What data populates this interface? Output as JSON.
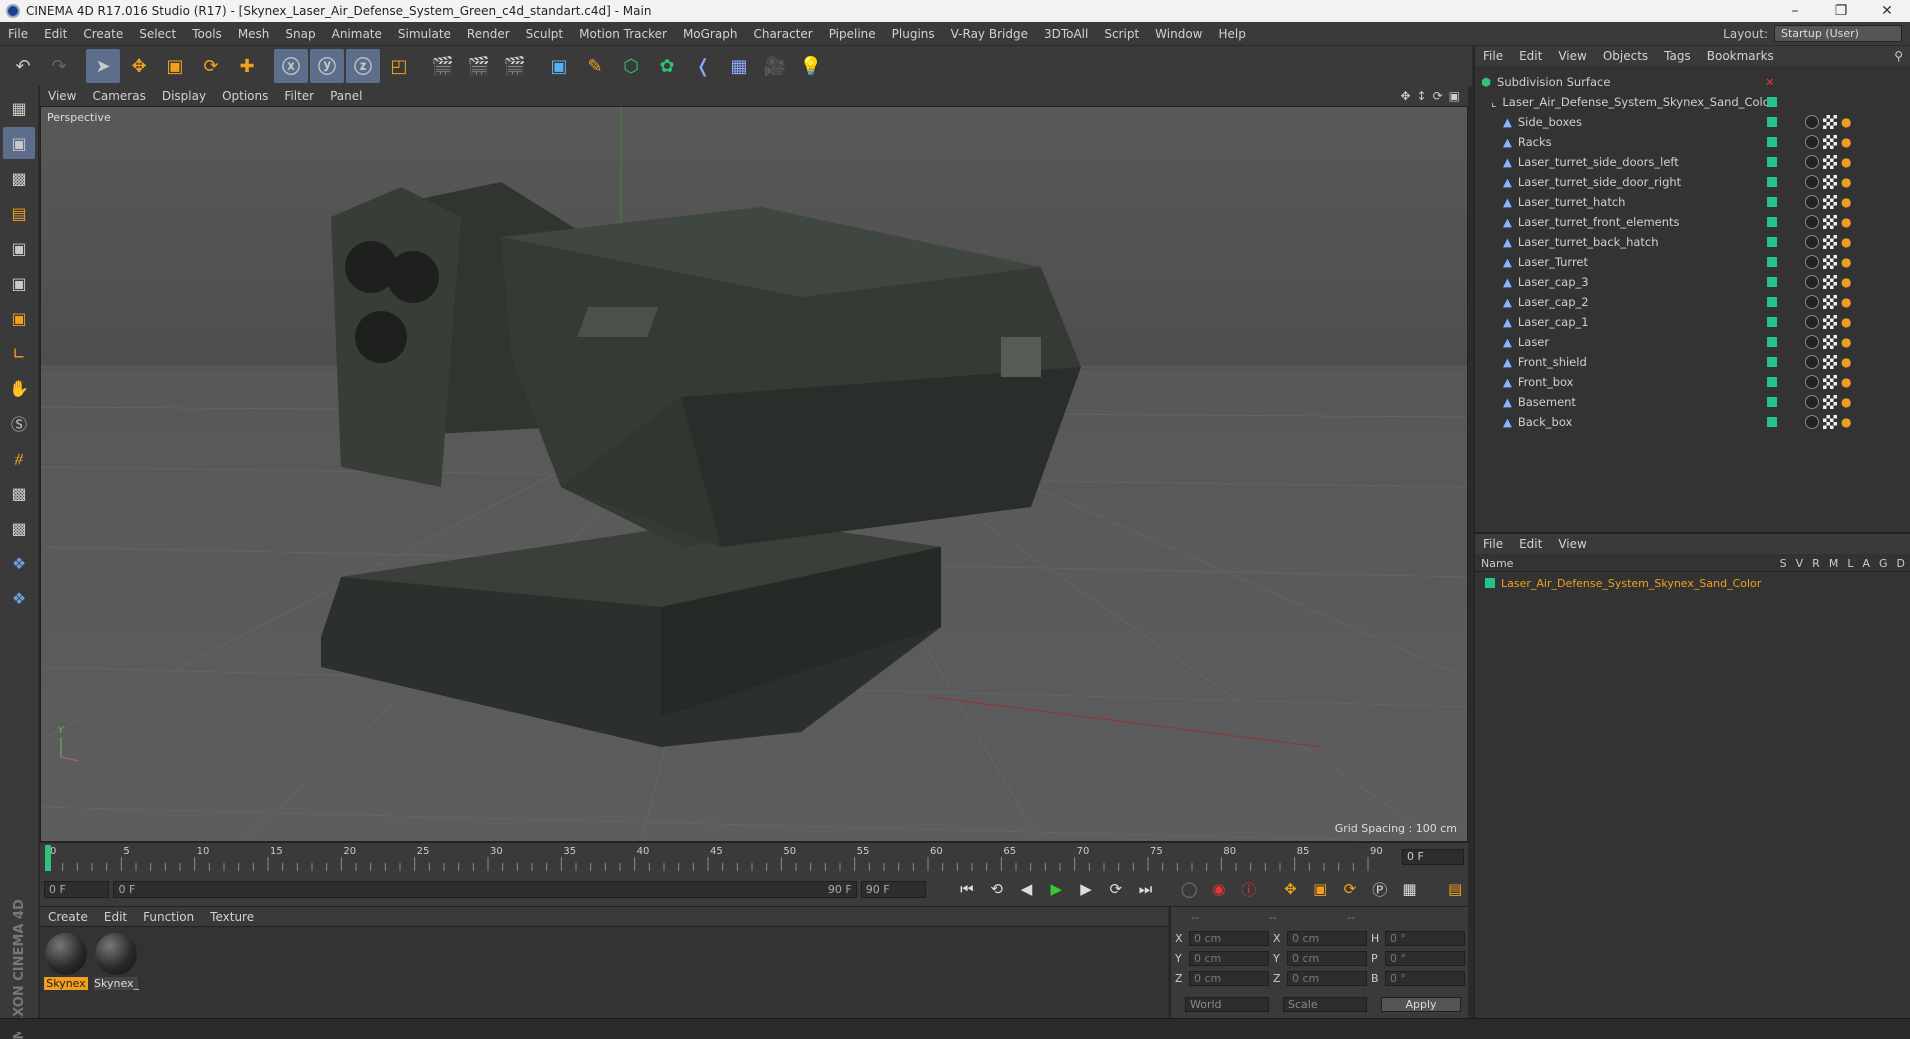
{
  "window": {
    "title": "CINEMA 4D R17.016 Studio (R17) - [Skynex_Laser_Air_Defense_System_Green_c4d_standart.c4d] - Main"
  },
  "menu": [
    "File",
    "Edit",
    "Create",
    "Select",
    "Tools",
    "Mesh",
    "Snap",
    "Animate",
    "Simulate",
    "Render",
    "Sculpt",
    "Motion Tracker",
    "MoGraph",
    "Character",
    "Pipeline",
    "Plugins",
    "V-Ray Bridge",
    "3DToAll",
    "Script",
    "Window",
    "Help"
  ],
  "layout": {
    "label": "Layout:",
    "value": "Startup (User)"
  },
  "viewport": {
    "menu": [
      "View",
      "Cameras",
      "Display",
      "Options",
      "Filter",
      "Panel"
    ],
    "camera": "Perspective",
    "grid_spacing": "Grid Spacing : 100 cm"
  },
  "timeline": {
    "ticks": [
      "0",
      "5",
      "10",
      "15",
      "20",
      "25",
      "30",
      "35",
      "40",
      "45",
      "50",
      "55",
      "60",
      "65",
      "70",
      "75",
      "80",
      "85",
      "90"
    ],
    "current_frame": "0 F",
    "start": "0 F",
    "range_start": "0 F",
    "range_end": "90 F",
    "end": "90 F"
  },
  "material_manager": {
    "menu": [
      "Create",
      "Edit",
      "Function",
      "Texture"
    ],
    "materials": [
      {
        "label": "Skynex",
        "selected": true
      },
      {
        "label": "Skynex_",
        "selected": false
      }
    ]
  },
  "coordinates": {
    "header": [
      "--",
      "--",
      "--"
    ],
    "rows": [
      {
        "a": "X",
        "av": "0 cm",
        "b": "X",
        "bv": "0 cm",
        "c": "H",
        "cv": "0 °"
      },
      {
        "a": "Y",
        "av": "0 cm",
        "b": "Y",
        "bv": "0 cm",
        "c": "P",
        "cv": "0 °"
      },
      {
        "a": "Z",
        "av": "0 cm",
        "b": "Z",
        "bv": "0 cm",
        "c": "B",
        "cv": "0 °"
      }
    ],
    "mode": "World",
    "scale": "Scale",
    "apply": "Apply"
  },
  "object_manager": {
    "menu": [
      "File",
      "Edit",
      "View",
      "Objects",
      "Tags",
      "Bookmarks"
    ],
    "root": "Subdivision Surface",
    "group": "Laser_Air_Defense_System_Skynex_Sand_Color",
    "children": [
      "Side_boxes",
      "Racks",
      "Laser_turret_side_doors_left",
      "Laser_turret_side_door_right",
      "Laser_turret_hatch",
      "Laser_turret_front_elements",
      "Laser_turret_back_hatch",
      "Laser_Turret",
      "Laser_cap_3",
      "Laser_cap_2",
      "Laser_cap_1",
      "Laser",
      "Front_shield",
      "Front_box",
      "Basement",
      "Back_box"
    ]
  },
  "attribute_manager": {
    "menu": [
      "File",
      "Edit",
      "View"
    ],
    "name_col": "Name",
    "cols": [
      "S",
      "V",
      "R",
      "M",
      "L",
      "A",
      "G",
      "D"
    ],
    "layer": "Laser_Air_Defense_System_Skynex_Sand_Color"
  }
}
